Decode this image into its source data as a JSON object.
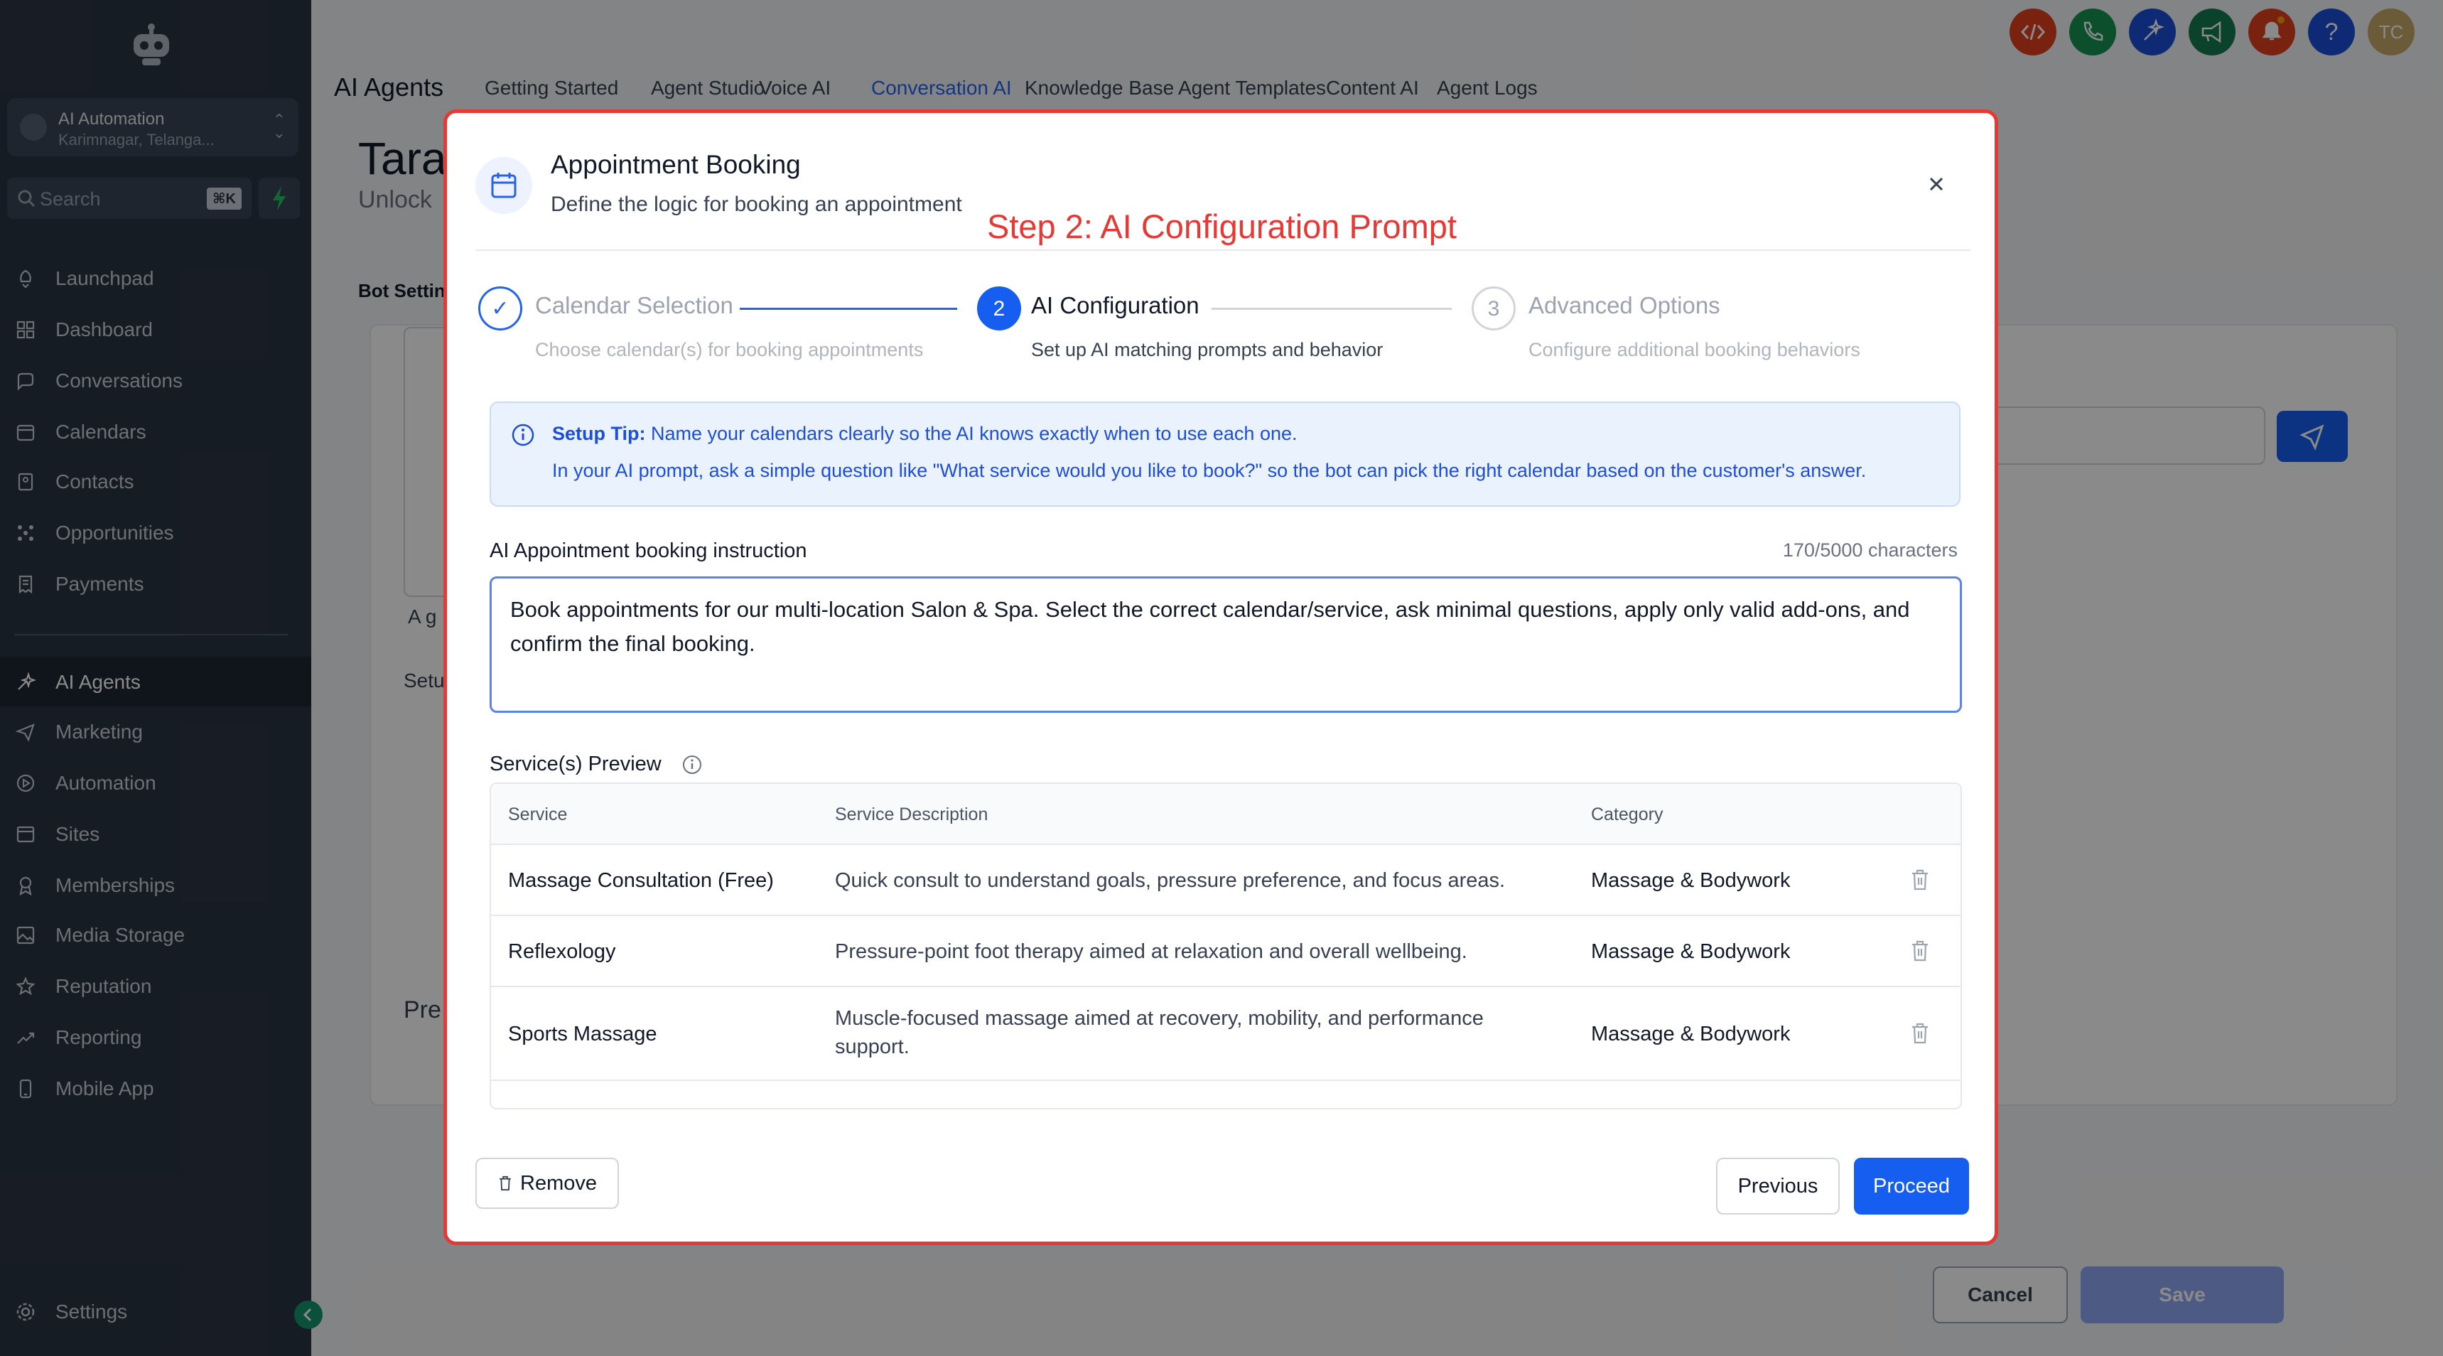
{
  "sidebar": {
    "account_name": "AI Automation",
    "account_location": "Karimnagar, Telanga...",
    "search_placeholder": "Search",
    "search_shortcut": "⌘K",
    "items": [
      {
        "label": "Launchpad",
        "icon": "rocket-icon"
      },
      {
        "label": "Dashboard",
        "icon": "grid-icon"
      },
      {
        "label": "Conversations",
        "icon": "chat-icon"
      },
      {
        "label": "Calendars",
        "icon": "calendar-icon"
      },
      {
        "label": "Contacts",
        "icon": "contacts-icon"
      },
      {
        "label": "Opportunities",
        "icon": "network-icon"
      },
      {
        "label": "Payments",
        "icon": "receipt-icon"
      },
      {
        "label": "AI Agents",
        "icon": "sparkle-icon"
      },
      {
        "label": "Marketing",
        "icon": "send-icon"
      },
      {
        "label": "Automation",
        "icon": "play-icon"
      },
      {
        "label": "Sites",
        "icon": "browser-icon"
      },
      {
        "label": "Memberships",
        "icon": "award-icon"
      },
      {
        "label": "Media Storage",
        "icon": "image-icon"
      },
      {
        "label": "Reputation",
        "icon": "star-icon"
      },
      {
        "label": "Reporting",
        "icon": "trend-icon"
      },
      {
        "label": "Mobile App",
        "icon": "phone-icon"
      }
    ],
    "settings_label": "Settings"
  },
  "header": {
    "title": "AI Agents",
    "tabs": [
      "Getting Started",
      "Agent Studio",
      "Voice AI",
      "Conversation AI",
      "Knowledge Base",
      "Agent Templates",
      "Content AI",
      "Agent Logs"
    ],
    "active_tab": "Conversation AI",
    "avatar_initials": "TC",
    "help_glyph": "?"
  },
  "background": {
    "heading_partial": "Tara",
    "sub_partial": "Unlock",
    "bot_settings_partial": "Bot Settin",
    "small_a": "A g",
    "small_setup": "Setu",
    "small_pre": "Pre",
    "cancel_label": "Cancel",
    "save_label": "Save"
  },
  "modal": {
    "title": "Appointment Booking",
    "description": "Define the logic for booking an appointment",
    "annotation": "Step 2: AI Configuration Prompt",
    "steps": [
      {
        "number": "✓",
        "title": "Calendar Selection",
        "desc": "Choose calendar(s) for booking appointments",
        "state": "done"
      },
      {
        "number": "2",
        "title": "AI Configuration",
        "desc": "Set up AI matching prompts and behavior",
        "state": "active"
      },
      {
        "number": "3",
        "title": "Advanced Options",
        "desc": "Configure additional booking behaviors",
        "state": "pending"
      }
    ],
    "tip_title": "Setup Tip:",
    "tip_line1": "Name your calendars clearly so the AI knows exactly when to use each one.",
    "tip_line2": "In your AI prompt, ask a simple question like \"What service would you like to book?\" so the bot can pick the right calendar based on the customer's answer.",
    "instruction_label": "AI Appointment booking instruction",
    "char_count": "170/5000 characters",
    "instruction_value": "Book appointments for our multi-location Salon & Spa. Select the correct calendar/service, ask minimal questions, apply only valid add-ons, and confirm the final booking.",
    "services_label": "Service(s) Preview",
    "table": {
      "headers": [
        "Service",
        "Service Description",
        "Category"
      ],
      "rows": [
        {
          "service": "Massage Consultation (Free)",
          "description": "Quick consult to understand goals, pressure preference, and focus areas.",
          "category": "Massage & Bodywork"
        },
        {
          "service": "Reflexology",
          "description": "Pressure-point foot therapy aimed at relaxation and overall wellbeing.",
          "category": "Massage & Bodywork"
        },
        {
          "service": "Sports Massage",
          "description": "Muscle-focused massage aimed at recovery, mobility, and performance support.",
          "category": "Massage & Bodywork"
        }
      ]
    },
    "remove_label": "Remove",
    "previous_label": "Previous",
    "proceed_label": "Proceed"
  },
  "colors": {
    "sidebar_bg": "#2a3444",
    "accent": "#155eef",
    "annotation_red": "#e53935"
  }
}
